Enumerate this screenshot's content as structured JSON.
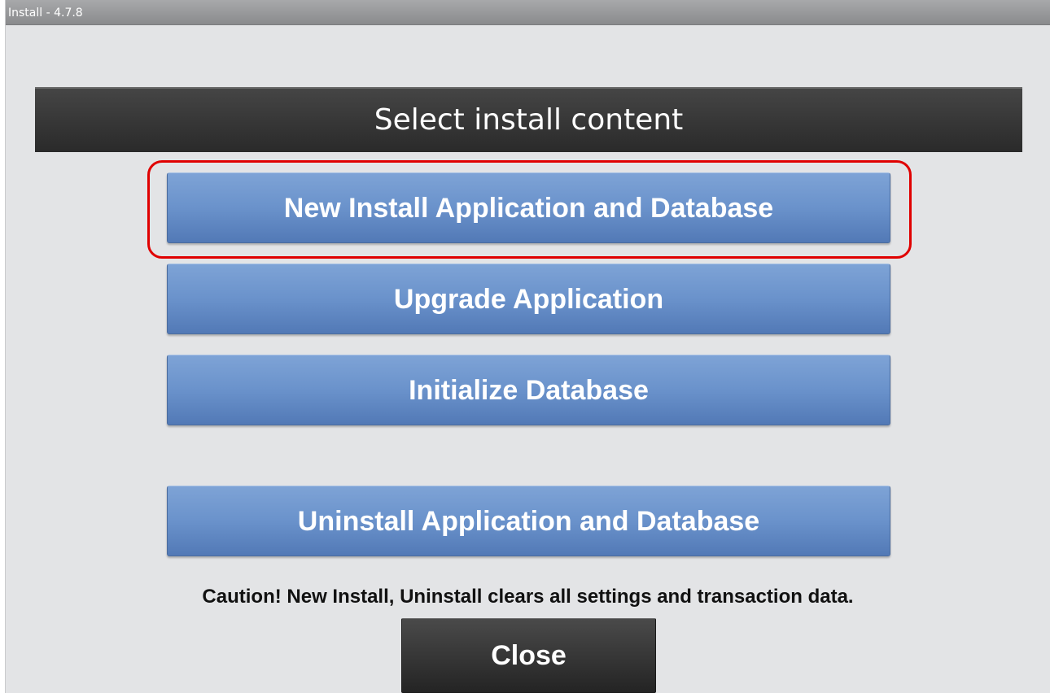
{
  "window": {
    "title": "Install - 4.7.8"
  },
  "header": {
    "title": "Select install content"
  },
  "buttons": {
    "new_install": "New Install Application and Database",
    "upgrade": "Upgrade Application",
    "initialize_db": "Initialize Database",
    "uninstall": "Uninstall Application and Database",
    "close": "Close"
  },
  "caution_text": "Caution! New Install, Uninstall clears all settings and transaction data.",
  "colors": {
    "button_blue": "#6a92cb",
    "header_dark": "#333333",
    "highlight_red": "#e00000"
  }
}
